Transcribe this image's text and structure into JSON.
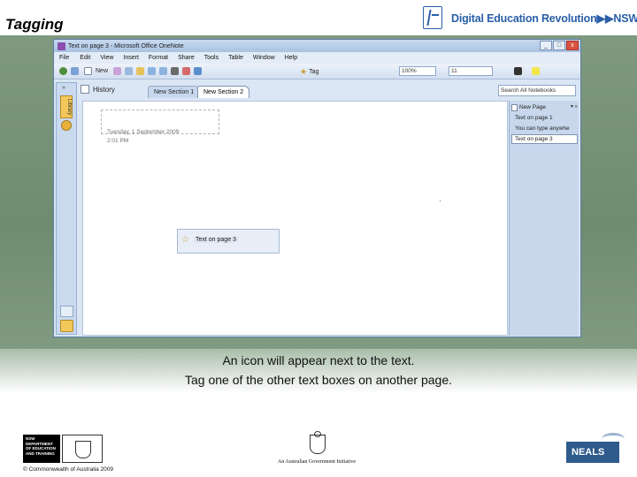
{
  "slide": {
    "title": "Tagging",
    "banner": "Digital Education Revolution▶▶NSW",
    "caption_line1": "An icon will appear next to the text.",
    "caption_line2": "Tag one of the other text boxes on another page.",
    "copyright": "© Commonwealth of Australia 2009",
    "dept_logo_text": "NSW DEPARTMENT OF EDUCATION AND TRAINING",
    "gov_text": "An Australian Government Initiative",
    "neals": "NEALS"
  },
  "window": {
    "title": "Text on page 3 - Microsoft Office OneNote",
    "controls": [
      "_",
      "□",
      "x"
    ]
  },
  "menu": {
    "items": [
      "File",
      "Edit",
      "View",
      "Insert",
      "Format",
      "Share",
      "Tools",
      "Table",
      "Window",
      "Help"
    ]
  },
  "toolbar": {
    "new_label": "New",
    "tag_label": "Tag",
    "zoom": "100%",
    "font_size": "11"
  },
  "navbar": {
    "notebook_label": "Library"
  },
  "sections": {
    "history": "History",
    "tabs": [
      "New Section 1",
      "New Section 2"
    ],
    "search_placeholder": "Search All Notebooks"
  },
  "page": {
    "date": "Tuesday, 1 September 2009",
    "time": "2:01 PM",
    "note_text": "Text on page 3"
  },
  "pages_panel": {
    "new_page": "New Page",
    "items": [
      "Text on page 1",
      "You can type anywhe",
      "Text on page 3"
    ]
  },
  "colors": {
    "frame_green": "#7f9a7e",
    "banner_blue": "#2a5fa8",
    "window_bg": "#dbe6f4"
  },
  "icons": [
    "app-icon",
    "star-icon",
    "history-icon",
    "new-page-icon",
    "notebook-icon"
  ]
}
